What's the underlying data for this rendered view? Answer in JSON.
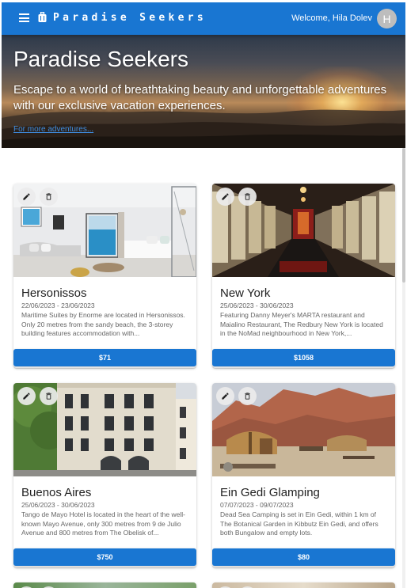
{
  "appbar": {
    "title": "Paradise Seekers",
    "welcome": "Welcome, Hila Dolev",
    "avatar_initial": "H",
    "color": "#1976d2"
  },
  "hero": {
    "title": "Paradise Seekers",
    "subtitle": "Escape to a world of breathtaking beauty and unforgettable adventures with our exclusive vacation experiences.",
    "link": "For more adventures..."
  },
  "vacations": [
    {
      "destination": "Hersonissos",
      "dates": "22/06/2023 - 23/06/2023",
      "description": "Maritime Suites by Enorme are located in Hersonissos. Only 20 metres from the sandy beach, the 3-storey building features accommodation with...",
      "price": "$71"
    },
    {
      "destination": "New York",
      "dates": "25/06/2023 - 30/06/2023",
      "description": "Featuring Danny Meyer's MARTA restaurant and Maialino Restaurant, The Redbury New York is located in the NoMad neighbourhood in New York,...",
      "price": "$1058"
    },
    {
      "destination": "Buenos Aires",
      "dates": "25/06/2023 - 30/06/2023",
      "description": "Tango de Mayo Hotel is located in the heart of the well-known Mayo Avenue, only 300 metres from 9 de Julio Avenue and 800 metres from The Obelisk of...",
      "price": "$750"
    },
    {
      "destination": "Ein Gedi Glamping",
      "dates": "07/07/2023 - 09/07/2023",
      "description": "Dead Sea Camping is set in Ein Gedi, within 1 km of The Botanical Garden in Kibbutz Ein Gedi, and offers both Bungalow and empty lots.",
      "price": "$80"
    }
  ]
}
